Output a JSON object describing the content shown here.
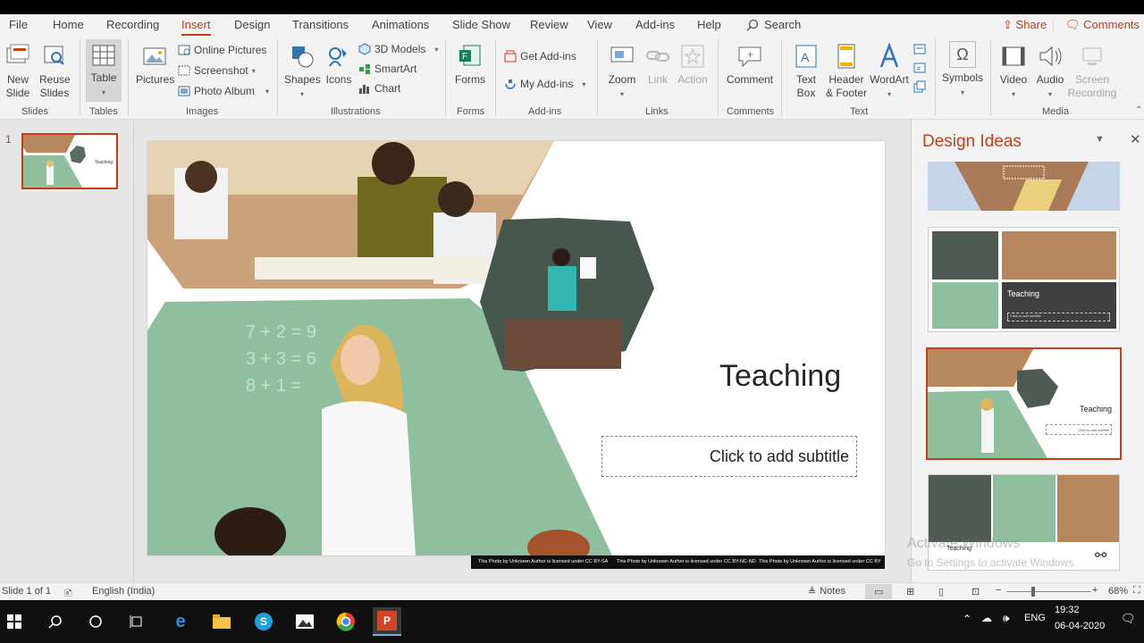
{
  "menubar": {
    "tabs": [
      "File",
      "Home",
      "Recording",
      "Insert",
      "Design",
      "Transitions",
      "Animations",
      "Slide Show",
      "Review",
      "View",
      "Add-ins",
      "Help"
    ],
    "active_tab": "Insert",
    "search_label": "Search",
    "share_label": "Share",
    "comments_label": "Comments"
  },
  "ribbon": {
    "slides": {
      "new_slide": "New\nSlide",
      "reuse_slides": "Reuse\nSlides",
      "label": "Slides"
    },
    "tables": {
      "table": "Table",
      "label": "Tables"
    },
    "images": {
      "pictures": "Pictures",
      "online_pictures": "Online Pictures",
      "screenshot": "Screenshot",
      "photo_album": "Photo Album",
      "label": "Images"
    },
    "illustrations": {
      "shapes": "Shapes",
      "icons": "Icons",
      "models_3d": "3D Models",
      "smartart": "SmartArt",
      "chart": "Chart",
      "label": "Illustrations"
    },
    "forms": {
      "forms": "Forms",
      "label": "Forms"
    },
    "addins": {
      "get_addins": "Get Add-ins",
      "my_addins": "My Add-ins",
      "label": "Add-ins"
    },
    "links": {
      "zoom": "Zoom",
      "link": "Link",
      "action": "Action",
      "label": "Links"
    },
    "comments": {
      "comment": "Comment",
      "label": "Comments"
    },
    "text": {
      "text_box": "Text\nBox",
      "header_footer": "Header\n& Footer",
      "wordart": "WordArt",
      "label": "Text"
    },
    "symbols": {
      "symbols": "Symbols"
    },
    "media": {
      "video": "Video",
      "audio": "Audio",
      "screen_recording": "Screen\nRecording",
      "label": "Media"
    }
  },
  "thumbnails": {
    "slide_number": "1",
    "thumb_title": "Teaching"
  },
  "slide": {
    "title": "Teaching",
    "subtitle_placeholder": "Click to add subtitle",
    "credits": [
      "This Photo by Unknown Author is licensed under CC BY-SA",
      "This Photo by Unknown Author is licensed under CC BY-NC-ND",
      "This Photo by Unknown Author is licensed under CC BY"
    ]
  },
  "design_pane": {
    "title": "Design Ideas",
    "idea_title": "Teaching",
    "idea_subtitle": "Click to add subtitle"
  },
  "watermark": {
    "line1": "Activate Windows",
    "line2": "Go to Settings to activate Windows."
  },
  "statusbar": {
    "slide_info": "Slide 1 of 1",
    "language": "English (India)",
    "notes": "Notes",
    "zoom": "68%"
  },
  "taskbar": {
    "time": "19:32",
    "date": "06-04-2020",
    "lang": "ENG"
  },
  "colors": {
    "accent": "#c43e1c",
    "chalkboard": "#8fbf9f",
    "slide_bg": "#ffffff"
  }
}
